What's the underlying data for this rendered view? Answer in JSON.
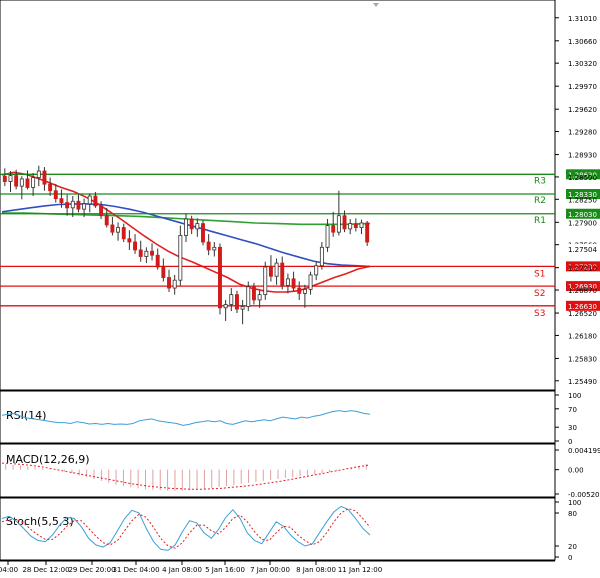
{
  "colors": {
    "up": "#1a7a1a",
    "down": "#d11a1a",
    "resistance": "#1a8a1a",
    "support": "#e01010",
    "ma_fast": "#e02020",
    "ma_slow": "#3050c0",
    "ma_long": "#30a030",
    "rsi": "#3aa0d8",
    "macd_hist": "#e0a0a0",
    "macd_signal": "#e02020",
    "stoch_k": "#3aa0d8",
    "stoch_d": "#e02020",
    "price_label_bg": "#222222"
  },
  "chart_data": {
    "type": "candlestick",
    "x_ticks": [
      "04:00",
      "28 Dec 12:00",
      "29 Dec 20:00",
      "31 Dec 04:00",
      "4 Jan 08:00",
      "5 Jan 16:00",
      "7 Jan 00:00",
      "8 Jan 08:00",
      "11 Jan 12:00"
    ],
    "price_axis": {
      "ylim": [
        1.2535,
        1.3125
      ],
      "ticks": [
        "1.31010",
        "1.30660",
        "1.30320",
        "1.29970",
        "1.29620",
        "1.29280",
        "1.28930",
        "1.28590",
        "1.28250",
        "1.27900",
        "1.27560",
        "1.27210",
        "1.26870",
        "1.26520",
        "1.26180",
        "1.25830",
        "1.25490"
      ]
    },
    "current_price": "1.27504",
    "levels": [
      {
        "name": "R3",
        "value": "1.28630",
        "type": "resistance"
      },
      {
        "name": "R2",
        "value": "1.28330",
        "type": "resistance"
      },
      {
        "name": "R1",
        "value": "1.28030",
        "type": "resistance"
      },
      {
        "name": "S1",
        "value": "1.27230",
        "type": "support"
      },
      {
        "name": "S2",
        "value": "1.26930",
        "type": "support"
      },
      {
        "name": "S3",
        "value": "1.26630",
        "type": "support"
      }
    ],
    "candles": [
      {
        "o": 1.286,
        "h": 1.2872,
        "l": 1.2845,
        "c": 1.2852
      },
      {
        "o": 1.2852,
        "h": 1.2868,
        "l": 1.2836,
        "c": 1.2861
      },
      {
        "o": 1.2861,
        "h": 1.287,
        "l": 1.284,
        "c": 1.2845
      },
      {
        "o": 1.2845,
        "h": 1.286,
        "l": 1.2825,
        "c": 1.2856
      },
      {
        "o": 1.2856,
        "h": 1.2869,
        "l": 1.284,
        "c": 1.2843
      },
      {
        "o": 1.2843,
        "h": 1.2865,
        "l": 1.283,
        "c": 1.2858
      },
      {
        "o": 1.2858,
        "h": 1.2876,
        "l": 1.2845,
        "c": 1.2868
      },
      {
        "o": 1.2868,
        "h": 1.2874,
        "l": 1.2838,
        "c": 1.2848
      },
      {
        "o": 1.2848,
        "h": 1.2858,
        "l": 1.283,
        "c": 1.2838
      },
      {
        "o": 1.2838,
        "h": 1.2848,
        "l": 1.282,
        "c": 1.2826
      },
      {
        "o": 1.2826,
        "h": 1.284,
        "l": 1.2812,
        "c": 1.282
      },
      {
        "o": 1.282,
        "h": 1.2832,
        "l": 1.28,
        "c": 1.2812
      },
      {
        "o": 1.2812,
        "h": 1.283,
        "l": 1.2798,
        "c": 1.2822
      },
      {
        "o": 1.2822,
        "h": 1.2832,
        "l": 1.2805,
        "c": 1.281
      },
      {
        "o": 1.281,
        "h": 1.2826,
        "l": 1.2798,
        "c": 1.2818
      },
      {
        "o": 1.2818,
        "h": 1.2834,
        "l": 1.2805,
        "c": 1.283
      },
      {
        "o": 1.283,
        "h": 1.2836,
        "l": 1.2812,
        "c": 1.2815
      },
      {
        "o": 1.2815,
        "h": 1.2822,
        "l": 1.2795,
        "c": 1.28
      },
      {
        "o": 1.28,
        "h": 1.2812,
        "l": 1.2782,
        "c": 1.2786
      },
      {
        "o": 1.2786,
        "h": 1.2798,
        "l": 1.277,
        "c": 1.2775
      },
      {
        "o": 1.2775,
        "h": 1.279,
        "l": 1.2762,
        "c": 1.2782
      },
      {
        "o": 1.2782,
        "h": 1.2788,
        "l": 1.276,
        "c": 1.2765
      },
      {
        "o": 1.2765,
        "h": 1.2778,
        "l": 1.2748,
        "c": 1.276
      },
      {
        "o": 1.276,
        "h": 1.2772,
        "l": 1.2742,
        "c": 1.2748
      },
      {
        "o": 1.2748,
        "h": 1.2762,
        "l": 1.273,
        "c": 1.2738
      },
      {
        "o": 1.2738,
        "h": 1.2752,
        "l": 1.2728,
        "c": 1.2746
      },
      {
        "o": 1.2746,
        "h": 1.2758,
        "l": 1.2732,
        "c": 1.274
      },
      {
        "o": 1.274,
        "h": 1.275,
        "l": 1.2718,
        "c": 1.2722
      },
      {
        "o": 1.2722,
        "h": 1.2735,
        "l": 1.27,
        "c": 1.2706
      },
      {
        "o": 1.2706,
        "h": 1.2718,
        "l": 1.2684,
        "c": 1.269
      },
      {
        "o": 1.269,
        "h": 1.271,
        "l": 1.268,
        "c": 1.2702
      },
      {
        "o": 1.2702,
        "h": 1.2785,
        "l": 1.2694,
        "c": 1.277
      },
      {
        "o": 1.277,
        "h": 1.2803,
        "l": 1.276,
        "c": 1.2795
      },
      {
        "o": 1.2795,
        "h": 1.28,
        "l": 1.2772,
        "c": 1.278
      },
      {
        "o": 1.278,
        "h": 1.2796,
        "l": 1.2768,
        "c": 1.2788
      },
      {
        "o": 1.2788,
        "h": 1.2793,
        "l": 1.2755,
        "c": 1.276
      },
      {
        "o": 1.276,
        "h": 1.2772,
        "l": 1.274,
        "c": 1.2748
      },
      {
        "o": 1.2748,
        "h": 1.276,
        "l": 1.2738,
        "c": 1.2752
      },
      {
        "o": 1.2752,
        "h": 1.2758,
        "l": 1.265,
        "c": 1.266
      },
      {
        "o": 1.266,
        "h": 1.2672,
        "l": 1.264,
        "c": 1.2665
      },
      {
        "o": 1.2665,
        "h": 1.269,
        "l": 1.2655,
        "c": 1.268
      },
      {
        "o": 1.268,
        "h": 1.2686,
        "l": 1.2652,
        "c": 1.2658
      },
      {
        "o": 1.2658,
        "h": 1.2672,
        "l": 1.2635,
        "c": 1.2662
      },
      {
        "o": 1.2662,
        "h": 1.27,
        "l": 1.2655,
        "c": 1.2692
      },
      {
        "o": 1.2692,
        "h": 1.2698,
        "l": 1.2665,
        "c": 1.2672
      },
      {
        "o": 1.2672,
        "h": 1.2686,
        "l": 1.266,
        "c": 1.268
      },
      {
        "o": 1.268,
        "h": 1.273,
        "l": 1.2672,
        "c": 1.2722
      },
      {
        "o": 1.2722,
        "h": 1.274,
        "l": 1.27,
        "c": 1.2708
      },
      {
        "o": 1.2708,
        "h": 1.2735,
        "l": 1.2695,
        "c": 1.2728
      },
      {
        "o": 1.2728,
        "h": 1.2738,
        "l": 1.2688,
        "c": 1.2694
      },
      {
        "o": 1.2694,
        "h": 1.2712,
        "l": 1.2682,
        "c": 1.2704
      },
      {
        "o": 1.2704,
        "h": 1.2715,
        "l": 1.2685,
        "c": 1.269
      },
      {
        "o": 1.269,
        "h": 1.27,
        "l": 1.2672,
        "c": 1.2682
      },
      {
        "o": 1.2682,
        "h": 1.2695,
        "l": 1.266,
        "c": 1.2688
      },
      {
        "o": 1.2688,
        "h": 1.2715,
        "l": 1.268,
        "c": 1.271
      },
      {
        "o": 1.271,
        "h": 1.273,
        "l": 1.2702,
        "c": 1.2724
      },
      {
        "o": 1.2724,
        "h": 1.276,
        "l": 1.2718,
        "c": 1.2752
      },
      {
        "o": 1.2752,
        "h": 1.2795,
        "l": 1.2745,
        "c": 1.2785
      },
      {
        "o": 1.2785,
        "h": 1.2806,
        "l": 1.2768,
        "c": 1.2775
      },
      {
        "o": 1.2775,
        "h": 1.2838,
        "l": 1.277,
        "c": 1.28
      },
      {
        "o": 1.28,
        "h": 1.2808,
        "l": 1.2775,
        "c": 1.278
      },
      {
        "o": 1.278,
        "h": 1.2795,
        "l": 1.2772,
        "c": 1.2788
      },
      {
        "o": 1.2788,
        "h": 1.2796,
        "l": 1.2776,
        "c": 1.2782
      },
      {
        "o": 1.2782,
        "h": 1.2794,
        "l": 1.2772,
        "c": 1.2789
      },
      {
        "o": 1.2789,
        "h": 1.2792,
        "l": 1.2754,
        "c": 1.276
      }
    ],
    "ma_fast": [
      1.2862,
      1.2866,
      1.2863,
      1.2857,
      1.285,
      1.2843,
      1.2837,
      1.2829,
      1.2819,
      1.2807,
      1.2795,
      1.2782,
      1.2769,
      1.2757,
      1.2746,
      1.2737,
      1.273,
      1.2722,
      1.2714,
      1.2706,
      1.2696,
      1.269,
      1.2686,
      1.2684,
      1.2684,
      1.2686,
      1.2692,
      1.2699,
      1.2706,
      1.2712,
      1.2719,
      1.2723
    ],
    "ma_slow": [
      1.2806,
      1.2809,
      1.2812,
      1.2815,
      1.2817,
      1.2818,
      1.2818,
      1.2817,
      1.2814,
      1.281,
      1.2805,
      1.2799,
      1.2793,
      1.2787,
      1.2781,
      1.2775,
      1.2769,
      1.2763,
      1.2757,
      1.275,
      1.2743,
      1.2737,
      1.2731,
      1.2727,
      1.2725,
      1.2724,
      1.2723
    ],
    "ma_long": [
      1.2804,
      1.2804,
      1.2803,
      1.2802,
      1.2801,
      1.28,
      1.2799,
      1.2797,
      1.2795,
      1.2793,
      1.2791,
      1.2789,
      1.2788,
      1.2787,
      1.2787,
      1.2787,
      1.2788
    ],
    "rsi": {
      "label": "RSI(14)",
      "ticks": [
        "100",
        "70",
        "30",
        "0"
      ],
      "ylim": [
        0,
        100
      ],
      "values": [
        56,
        58,
        60,
        54,
        50,
        48,
        46,
        44,
        42,
        40,
        40,
        38,
        42,
        40,
        37,
        38,
        36,
        38,
        36,
        37,
        36,
        38,
        44,
        46,
        48,
        44,
        42,
        40,
        38,
        34,
        36,
        40,
        42,
        44,
        42,
        44,
        38,
        36,
        40,
        44,
        42,
        44,
        46,
        44,
        48,
        52,
        50,
        48,
        52,
        50,
        54,
        56,
        60,
        64,
        66,
        64,
        66,
        64,
        60,
        58
      ]
    },
    "macd": {
      "label": "MACD(12,26,9)",
      "ticks": [
        "0.004199",
        "0.00",
        "-0.005205"
      ],
      "ylim": [
        -0.005205,
        0.004199
      ],
      "hist": [
        0.0012,
        0.001,
        0.0009,
        0.0007,
        0.0005,
        0.0003,
        0.0001,
        -0.0001,
        -0.0004,
        -0.0008,
        -0.0012,
        -0.0016,
        -0.002,
        -0.0024,
        -0.0028,
        -0.0032,
        -0.0035,
        -0.0038,
        -0.004,
        -0.0042,
        -0.0043,
        -0.0044,
        -0.0045,
        -0.0045,
        -0.0045,
        -0.0044,
        -0.0043,
        -0.0041,
        -0.0039,
        -0.0037,
        -0.0035,
        -0.0033,
        -0.003,
        -0.0028,
        -0.0026,
        -0.0024,
        -0.0022,
        -0.002,
        -0.0018,
        -0.0016,
        -0.0014,
        -0.0012,
        -0.001,
        -0.0008,
        -0.0005,
        -0.0002,
        0.0001,
        0.0004,
        0.0008,
        0.0012
      ],
      "signal": [
        0.0014,
        0.0013,
        0.0011,
        0.0009,
        0.0006,
        0.0002,
        -0.0002,
        -0.0006,
        -0.001,
        -0.0014,
        -0.0018,
        -0.0022,
        -0.0026,
        -0.003,
        -0.0033,
        -0.0036,
        -0.0038,
        -0.004,
        -0.0041,
        -0.0042,
        -0.0042,
        -0.0041,
        -0.004,
        -0.0038,
        -0.0036,
        -0.0034,
        -0.0031,
        -0.0028,
        -0.0025,
        -0.0021,
        -0.0017,
        -0.0013,
        -0.0009,
        -0.0005,
        -0.0001,
        0.0003,
        0.0007,
        0.001
      ]
    },
    "stoch": {
      "label": "Stoch(5,5,3)",
      "ticks": [
        "100",
        "80",
        "20",
        "0"
      ],
      "ylim": [
        0,
        100
      ],
      "k": [
        70,
        74,
        65,
        52,
        38,
        30,
        28,
        40,
        58,
        72,
        70,
        55,
        34,
        22,
        18,
        26,
        48,
        70,
        85,
        80,
        52,
        28,
        14,
        12,
        22,
        46,
        66,
        62,
        44,
        34,
        50,
        72,
        86,
        70,
        44,
        30,
        24,
        44,
        64,
        56,
        40,
        28,
        20,
        24,
        44,
        64,
        82,
        92,
        86,
        70,
        52,
        40
      ],
      "d": [
        64,
        68,
        68,
        62,
        50,
        40,
        32,
        32,
        42,
        56,
        66,
        66,
        52,
        38,
        26,
        22,
        30,
        48,
        66,
        78,
        72,
        54,
        34,
        20,
        16,
        26,
        44,
        58,
        58,
        48,
        42,
        54,
        70,
        76,
        64,
        46,
        32,
        30,
        44,
        56,
        54,
        40,
        30,
        22,
        28,
        44,
        64,
        80,
        88,
        84,
        70,
        54
      ]
    }
  }
}
